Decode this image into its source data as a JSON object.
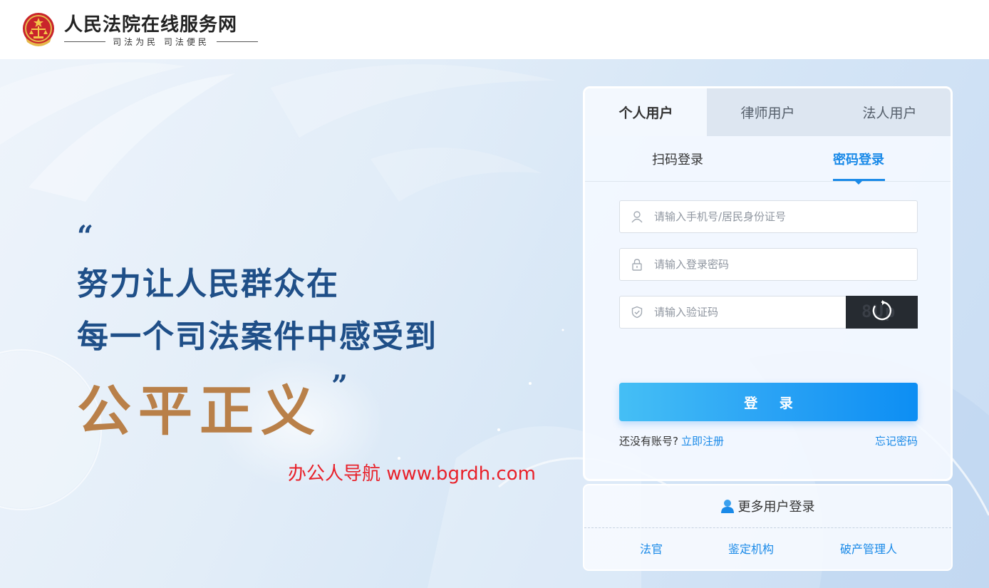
{
  "header": {
    "site_title": "人民法院在线服务网",
    "slogan": "司法为民  司法便民"
  },
  "hero": {
    "quote_open": "“",
    "line1": "努力让人民群众在",
    "line2": "每一个司法案件中感受到",
    "line3": "公平正义",
    "quote_close": "”",
    "watermark": "办公人导航  www.bgrdh.com"
  },
  "login": {
    "user_tabs": [
      {
        "label": "个人用户",
        "active": true
      },
      {
        "label": "律师用户",
        "active": false
      },
      {
        "label": "法人用户",
        "active": false
      }
    ],
    "modes": {
      "scan": "扫码登录",
      "password": "密码登录",
      "active": "password"
    },
    "fields": {
      "account_placeholder": "请输入手机号/居民身份证号",
      "password_placeholder": "请输入登录密码",
      "captcha_placeholder": "请输入验证码"
    },
    "captcha_text": "8Up",
    "submit_label": "登 录",
    "no_account_text": "还没有账号?",
    "register_label": "立即注册",
    "forgot_label": "忘记密码"
  },
  "more_users": {
    "title": "更多用户登录",
    "links": [
      "法官",
      "鉴定机构",
      "破产管理人"
    ]
  },
  "colors": {
    "accent": "#1a8ae8",
    "slogan_blue": "#1f4f88",
    "slogan_gold": "#b98049",
    "watermark_red": "#e8212a"
  }
}
